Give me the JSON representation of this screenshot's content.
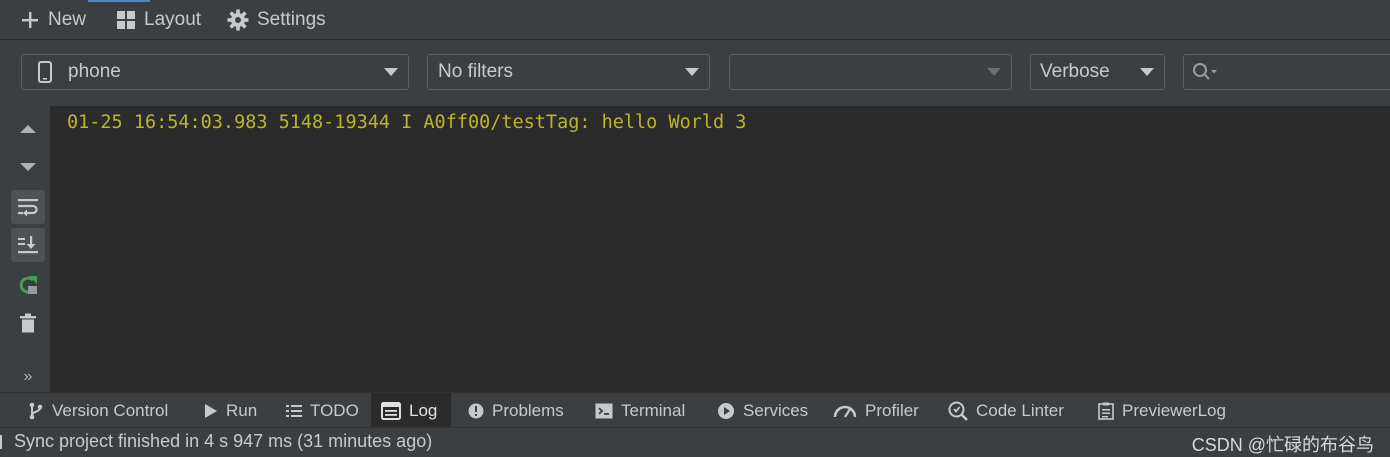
{
  "toolbar": {
    "new_label": "New",
    "layout_label": "Layout",
    "settings_label": "Settings"
  },
  "filters": {
    "device": "phone",
    "filter": "No filters",
    "process": "",
    "level": "Verbose",
    "search_placeholder": ""
  },
  "log": {
    "lines": [
      "01-25 16:54:03.983 5148-19344 I A0ff00/testTag: hello World 3"
    ]
  },
  "bottom_tabs": [
    {
      "label": "Version Control",
      "icon": "branch-icon"
    },
    {
      "label": "Run",
      "icon": "play-icon"
    },
    {
      "label": "TODO",
      "icon": "list-icon"
    },
    {
      "label": "Log",
      "icon": "log-icon",
      "active": true
    },
    {
      "label": "Problems",
      "icon": "warning-icon"
    },
    {
      "label": "Terminal",
      "icon": "terminal-icon"
    },
    {
      "label": "Services",
      "icon": "services-icon"
    },
    {
      "label": "Profiler",
      "icon": "gauge-icon"
    },
    {
      "label": "Code Linter",
      "icon": "linter-icon"
    },
    {
      "label": "PreviewerLog",
      "icon": "document-icon"
    }
  ],
  "status": {
    "message": "Sync project finished in 4 s 947 ms (31 minutes ago)",
    "watermark": "CSDN @忙碌的布谷鸟"
  },
  "colors": {
    "background": "#3c3f41",
    "log_background": "#2b2b2b",
    "log_text": "#bbb529",
    "accent": "#4a88c7",
    "refresh_green": "#499c54"
  }
}
